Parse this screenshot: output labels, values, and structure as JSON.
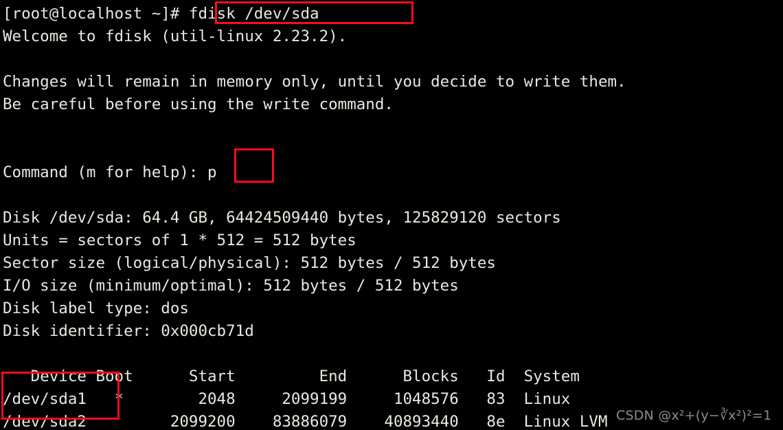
{
  "terminal": {
    "prompt": "[root@localhost ~]# ",
    "command": "fdisk /dev/sda",
    "lines": [
      "Welcome to fdisk (util-linux 2.23.2).",
      "",
      "Changes will remain in memory only, until you decide to write them.",
      "Be careful before using the write command.",
      "",
      ""
    ],
    "command_prompt_label": "Command (m for help): ",
    "command_input": "p",
    "blank_after_command": "",
    "disk_info": [
      "Disk /dev/sda: 64.4 GB, 64424509440 bytes, 125829120 sectors",
      "Units = sectors of 1 * 512 = 512 bytes",
      "Sector size (logical/physical): 512 bytes / 512 bytes",
      "I/O size (minimum/optimal): 512 bytes / 512 bytes",
      "Disk label type: dos",
      "Disk identifier: 0x000cb71d"
    ],
    "blank_before_table": "",
    "table_header": "   Device Boot      Start         End      Blocks   Id  System",
    "table_rows": [
      "/dev/sda1   *        2048     2099199     1048576   83  Linux",
      "/dev/sda2         2099200    83886079    40893440   8e  Linux LVM"
    ]
  },
  "partition_table": {
    "columns": [
      "Device",
      "Boot",
      "Start",
      "End",
      "Blocks",
      "Id",
      "System"
    ],
    "rows": [
      {
        "device": "/dev/sda1",
        "boot": "*",
        "start": "2048",
        "end": "2099199",
        "blocks": "1048576",
        "id": "83",
        "system": "Linux"
      },
      {
        "device": "/dev/sda2",
        "boot": "",
        "start": "2099200",
        "end": "83886079",
        "blocks": "40893440",
        "id": "8e",
        "system": "Linux LVM"
      }
    ]
  },
  "disk_summary": {
    "device": "/dev/sda",
    "size_human": "64.4 GB",
    "size_bytes": "64424509440",
    "sectors": "125829120",
    "unit_size": "512",
    "logical_sector_size": "512 bytes",
    "physical_sector_size": "512 bytes",
    "io_minimum": "512 bytes",
    "io_optimal": "512 bytes",
    "label_type": "dos",
    "identifier": "0x000cb71d"
  },
  "annotations": {
    "highlight_color": "#fc0d1b",
    "command_box_label": "fdisk /dev/sda",
    "input_box_label": "p",
    "devices_box_label": "/dev/sda1 /dev/sda2"
  },
  "watermark": {
    "text": "CSDN @x²+(y−∛x²)²=1"
  },
  "colors": {
    "background": "#000000",
    "foreground": "#e9e9e1",
    "accent_red": "#fc0d1b"
  }
}
